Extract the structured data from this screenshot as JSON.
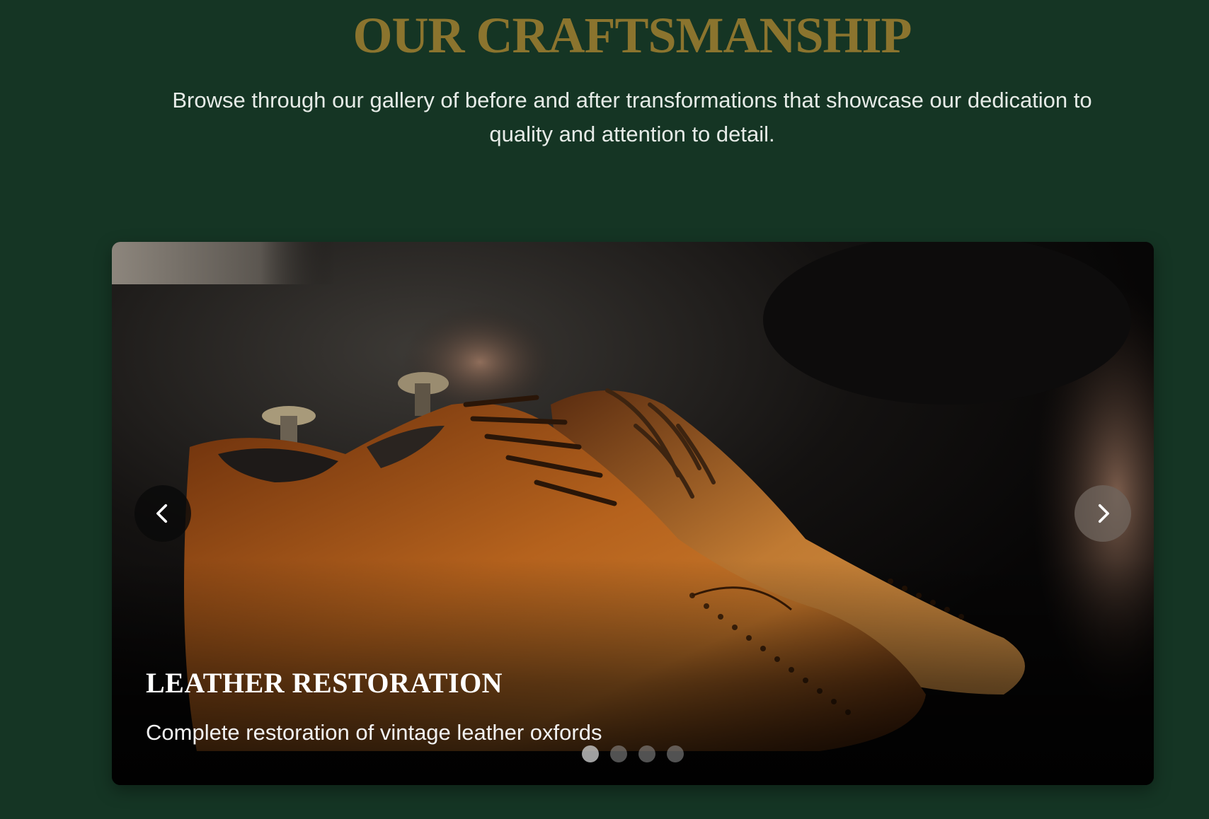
{
  "section": {
    "title": "OUR CRAFTSMANSHIP",
    "subtitle": "Browse through our gallery of before and after transformations that showcase our dedication to quality and attention to detail."
  },
  "carousel": {
    "slide": {
      "title": "LEATHER RESTORATION",
      "description": "Complete restoration of vintage leather oxfords",
      "image": "brown-leather-oxford-shoes-photo"
    },
    "prev_icon": "chevron-left-icon",
    "next_icon": "chevron-right-icon",
    "dots": [
      {
        "active": true
      },
      {
        "active": false
      },
      {
        "active": false
      },
      {
        "active": false
      }
    ]
  },
  "colors": {
    "background": "#153524",
    "title_gold": "#8b742e",
    "leather": "#b0601c"
  }
}
